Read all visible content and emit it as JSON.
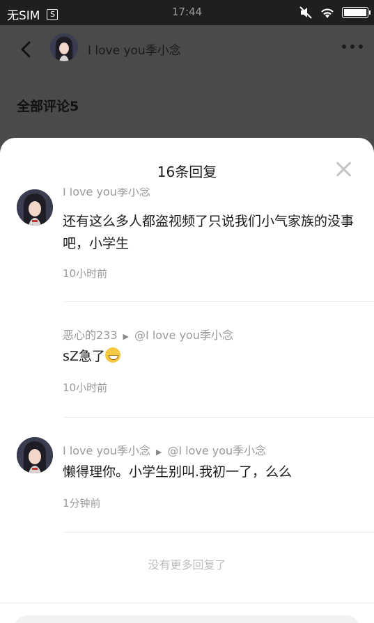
{
  "status": {
    "carrier": "无SIM",
    "sim_badge": "S",
    "time": "17:44",
    "battery_level": 1.0
  },
  "header": {
    "username": "I love you季小念"
  },
  "comments_label": "全部评论5",
  "sheet": {
    "title": "16条回复",
    "replies": [
      {
        "author": "I love you季小念",
        "text": "还有这么多人都盗视频了只说我们小气家族的没事吧，小学生",
        "time": "10小时前"
      },
      {
        "author": "恶心的233",
        "reply_to": "@I love you季小念",
        "text": "sZ急了",
        "emoji": "grinning-face",
        "time": "10小时前"
      },
      {
        "author": "I love you季小念",
        "reply_to": "@I love you季小念",
        "text": "懒得理你。小学生别叫.我初一了，么么",
        "time": "1分钟前"
      }
    ],
    "no_more": "没有更多回复了"
  },
  "colors": {
    "sheet_bg": "#ffffff",
    "overlay": "#4a4a4a",
    "meta_text": "#9a9a9a"
  }
}
